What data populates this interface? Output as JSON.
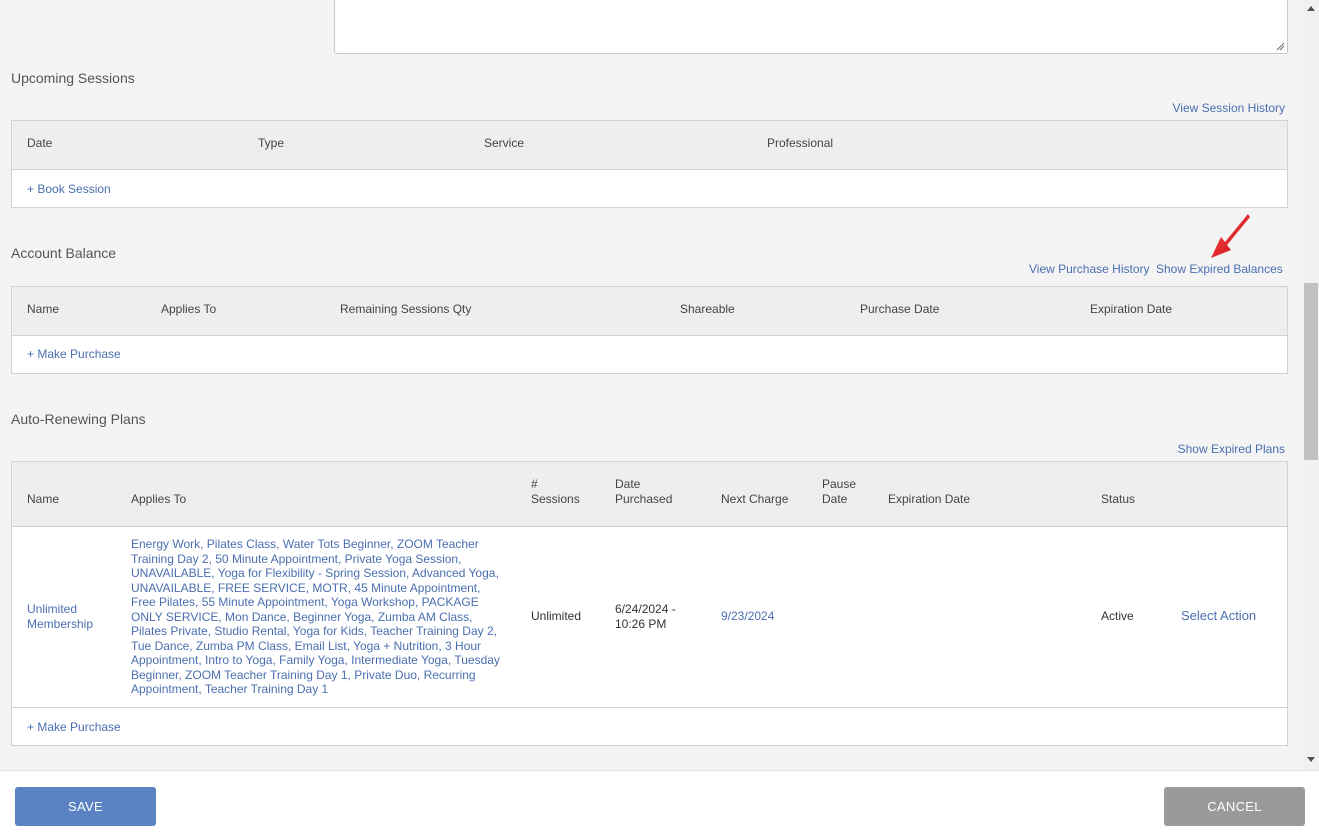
{
  "notes": {
    "value": ""
  },
  "upcoming": {
    "title": "Upcoming Sessions",
    "view_history": "View Session History",
    "headers": [
      "Date",
      "Type",
      "Service",
      "Professional"
    ],
    "book_session": "+ Book Session"
  },
  "balance": {
    "title": "Account Balance",
    "view_purchase_history": "View Purchase History",
    "show_expired": "Show Expired Balances",
    "headers": [
      "Name",
      "Applies To",
      "Remaining Sessions Qty",
      "Shareable",
      "Purchase Date",
      "Expiration Date"
    ],
    "make_purchase": "+ Make Purchase"
  },
  "plans": {
    "title": "Auto-Renewing Plans",
    "show_expired": "Show Expired Plans",
    "headers": {
      "name": "Name",
      "applies_to": "Applies To",
      "sessions": "# Sessions",
      "date_purchased": "Date Purchased",
      "next_charge": "Next Charge",
      "pause_date": "Pause Date",
      "expiration_date": "Expiration Date",
      "status": "Status"
    },
    "row": {
      "name": "Unlimited Membership",
      "applies_to": "Energy Work, Pilates Class, Water Tots Beginner, ZOOM Teacher Training Day 2, 50 Minute Appointment, Private Yoga Session, UNAVAILABLE, Yoga for Flexibility - Spring Session, Advanced Yoga, UNAVAILABLE, FREE SERVICE, MOTR, 45 Minute Appointment, Free Pilates, 55 Minute Appointment, Yoga Workshop, PACKAGE ONLY SERVICE, Mon Dance, Beginner Yoga, Zumba AM Class, Pilates Private, Studio Rental, Yoga for Kids, Teacher Training Day 2, Tue Dance, Zumba PM Class, Email List, Yoga + Nutrition, 3 Hour Appointment, Intro to Yoga, Family Yoga, Intermediate Yoga, Tuesday Beginner, ZOOM Teacher Training Day 1, Private Duo, Recurring Appointment, Teacher Training Day 1",
      "sessions": "Unlimited",
      "date_purchased": "6/24/2024 - 10:26 PM",
      "next_charge": "9/23/2024",
      "pause_date": "",
      "expiration_date": "",
      "status": "Active",
      "action": "Select Action"
    },
    "make_purchase": "+ Make Purchase"
  },
  "footer": {
    "save": "SAVE",
    "cancel": "CANCEL"
  },
  "colors": {
    "link": "#4a6fb0",
    "save": "#5b82c2",
    "cancel": "#9a9a9a",
    "annotation_arrow": "#e8121b"
  }
}
